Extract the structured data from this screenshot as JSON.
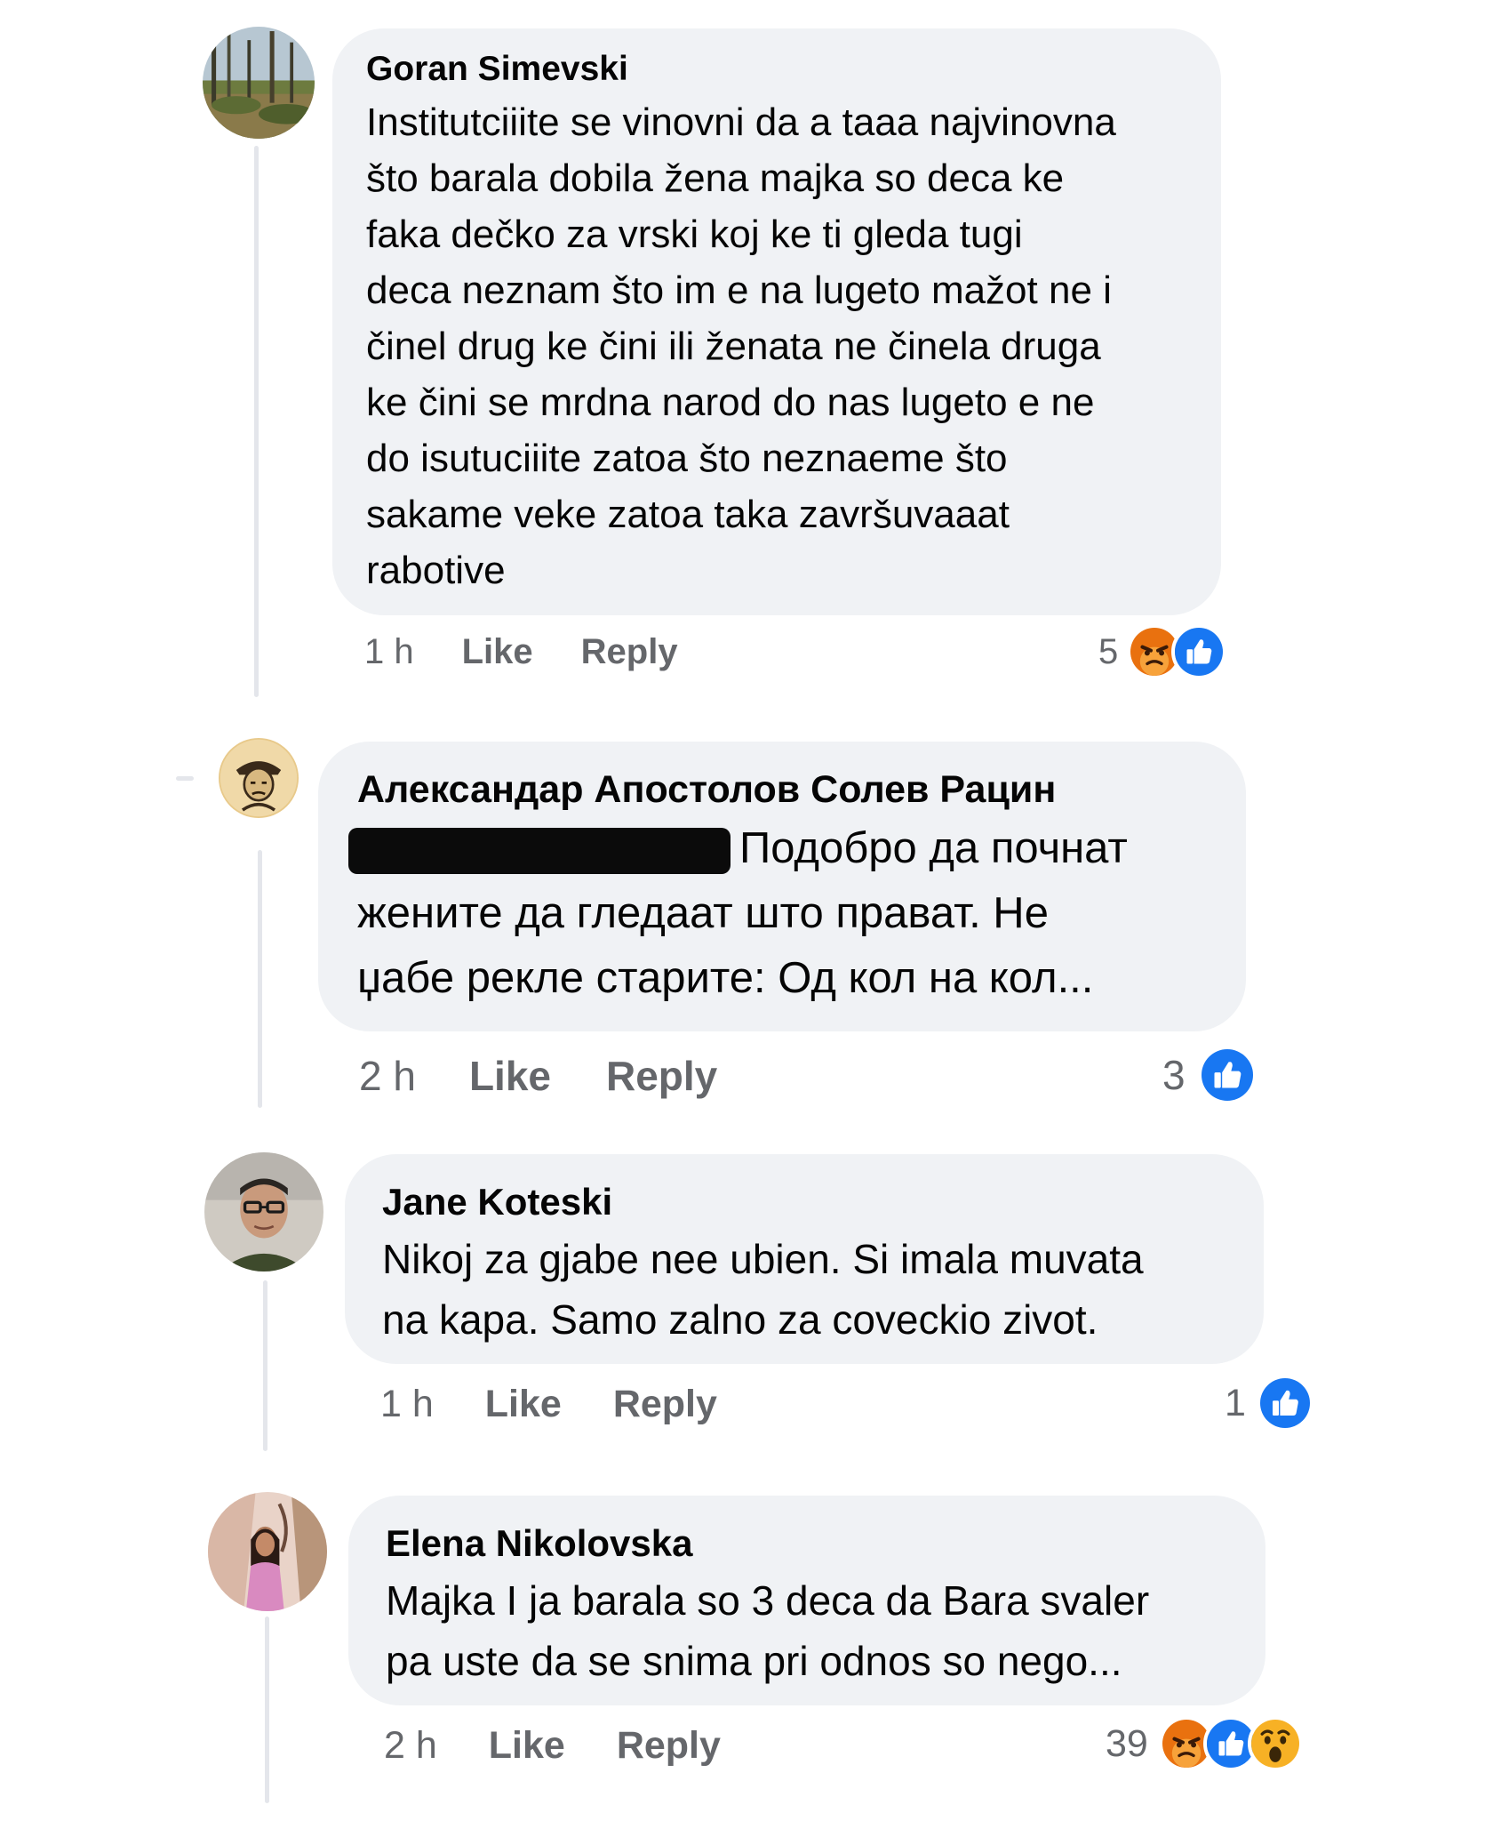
{
  "comments": [
    {
      "author": "Goran Simevski",
      "text": "Institutciiite se vinovni da a taaa najvinovna što barala dobila žena majka so deca ke faka dečko za vrski koj ke ti gleda tugi deca neznam što im e na lugeto mažot ne i činel drug ke čini ili ženata ne činela druga ke čini se mrdna narod do nas lugeto e ne do isutuciiite zatoa što neznaeme što sakame veke zatoa taka završuvaaat rabotive",
      "lines": [
        "Institutciiite se vinovni da a taaa najvinovna",
        "što barala dobila žena majka so deca ke",
        "faka dečko za vrski koj ke ti gleda tugi",
        "deca neznam što im e na lugeto mažot ne i",
        "činel drug ke čini ili ženata ne činela druga",
        "ke čini se mrdna narod do nas lugeto e ne",
        "do isutuciiite zatoa što neznaeme što",
        "sakame veke zatoa taka završuvaaat",
        "rabotive"
      ],
      "time": "1 h",
      "like_label": "Like",
      "reply_label": "Reply",
      "reaction_count": "5",
      "reactions": [
        "angry-icon",
        "like-icon"
      ]
    },
    {
      "author": "Александар Апостолов Солев Рацин",
      "line1_after_redaction": "Подобро да почнат",
      "line2": "жените да гледаат што прават. Не",
      "line3": "џабе рекле старите: Од кол на кол...",
      "time": "2 h",
      "like_label": "Like",
      "reply_label": "Reply",
      "reaction_count": "3",
      "reactions": [
        "like-icon"
      ]
    },
    {
      "author": "Jane Koteski",
      "line1": "Nikoj za gjabe nee ubien. Si imala muvata",
      "line2": "na kapa. Samo zalno za coveckio zivot.",
      "time": "1 h",
      "like_label": "Like",
      "reply_label": "Reply",
      "reaction_count": "1",
      "reactions": [
        "like-icon"
      ]
    },
    {
      "author": "Elena Nikolovska",
      "line1": "Majka I ja barala so 3 deca da Bara svaler",
      "line2": "pa uste da se snima pri odnos so nego...",
      "time": "2 h",
      "like_label": "Like",
      "reply_label": "Reply",
      "reaction_count": "39",
      "reactions": [
        "angry-icon",
        "like-icon",
        "wow-icon"
      ]
    }
  ],
  "colors": {
    "bubble": "#f0f2f5",
    "meta_text": "#65676b",
    "like_blue": "#1877f2",
    "angry_orange": "#e9710f",
    "wow_yellow": "#f7b125"
  }
}
